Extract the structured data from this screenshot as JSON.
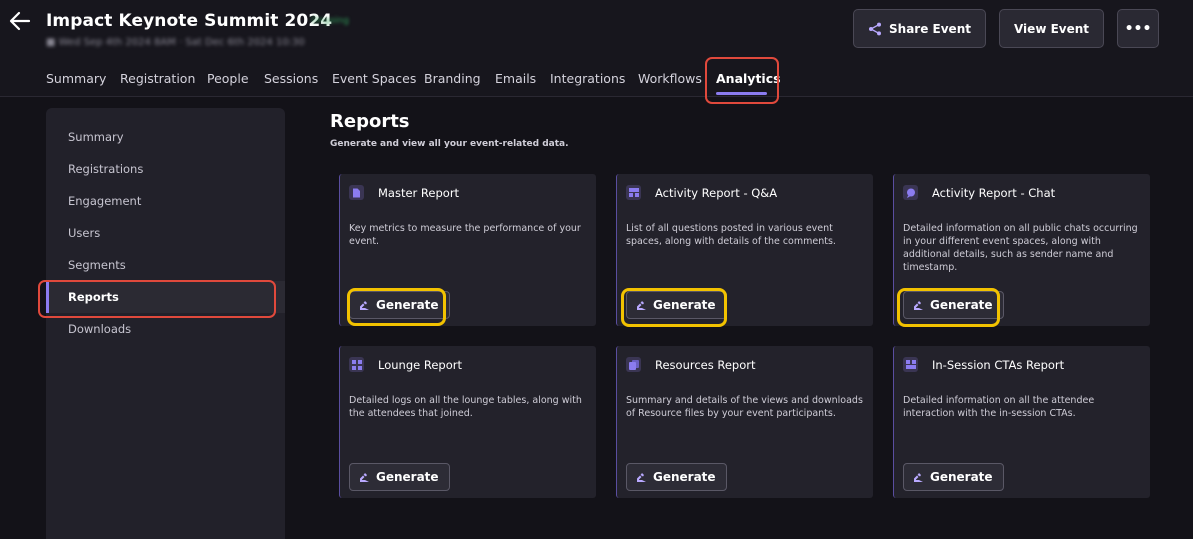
{
  "header": {
    "title": "Impact Keynote Summit 2024",
    "status": "Ongoing",
    "subline": "■ Wed Sep 4th 2024 8AM · Sat Dec 6th 2024 10:30",
    "share_label": "Share Event",
    "view_label": "View Event",
    "more_label": "•••"
  },
  "nav": {
    "tabs": [
      {
        "label": "Summary"
      },
      {
        "label": "Registration"
      },
      {
        "label": "People"
      },
      {
        "label": "Sessions"
      },
      {
        "label": "Event Spaces"
      },
      {
        "label": "Branding"
      },
      {
        "label": "Emails"
      },
      {
        "label": "Integrations"
      },
      {
        "label": "Workflows"
      },
      {
        "label": "Analytics"
      }
    ],
    "active_tab": "Analytics"
  },
  "sidebar": {
    "items": [
      {
        "label": "Summary"
      },
      {
        "label": "Registrations"
      },
      {
        "label": "Engagement"
      },
      {
        "label": "Users"
      },
      {
        "label": "Segments"
      },
      {
        "label": "Reports"
      },
      {
        "label": "Downloads"
      }
    ],
    "active_item": "Reports"
  },
  "main": {
    "title": "Reports",
    "subtitle": "Generate and view all your event-related data.",
    "cards": [
      {
        "title": "Master Report",
        "description": "Key metrics to measure the performance of your event.",
        "button": "Generate",
        "icon": "document-icon"
      },
      {
        "title": "Activity Report - Q&A",
        "description": "List of all questions posted in various event spaces, along with details of the comments.",
        "button": "Generate",
        "icon": "qa-grid-icon"
      },
      {
        "title": "Activity Report - Chat",
        "description": "Detailed information on all public chats occurring in your different event spaces, along with additional details, such as sender name and timestamp.",
        "button": "Generate",
        "icon": "chat-bubble-icon"
      },
      {
        "title": "Lounge Report",
        "description": "Detailed logs on all the lounge tables, along with the attendees that joined.",
        "button": "Generate",
        "icon": "lounge-grid-icon"
      },
      {
        "title": "Resources Report",
        "description": "Summary and details of the views and downloads of Resource files by your event participants.",
        "button": "Generate",
        "icon": "files-icon"
      },
      {
        "title": "In-Session CTAs Report",
        "description": "Detailed information on all the attendee interaction with the in-session CTAs.",
        "button": "Generate",
        "icon": "cta-grid-icon"
      }
    ]
  },
  "colors": {
    "accent": "#8b7cf0",
    "highlight_red": "#e0493c",
    "highlight_yellow": "#f2c200",
    "status_green": "#2f9e58"
  }
}
